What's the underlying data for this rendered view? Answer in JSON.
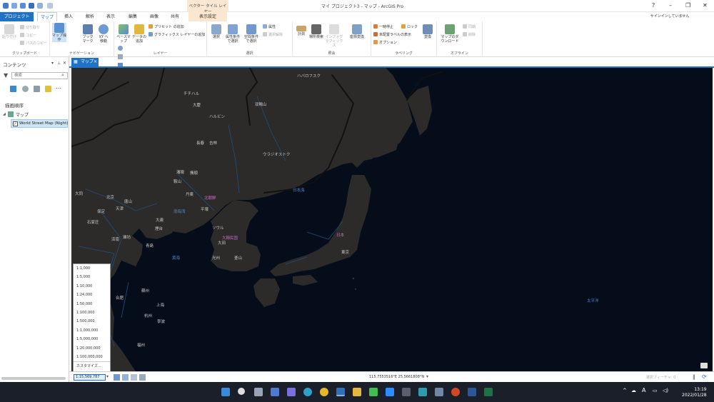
{
  "title_bar": {
    "title": "マイ プロジェクト3 - マップ - ArcGIS Pro",
    "context_header": "ベクター タイル レイヤー",
    "help": "?",
    "minimize": "–",
    "restore": "❐",
    "close": "✕"
  },
  "tabs": {
    "project": "プロジェクト",
    "map": "マップ",
    "insert": "挿入",
    "analysis": "解析",
    "view": "表示",
    "edit": "編集",
    "imagery": "画像",
    "share": "共有",
    "display_settings": "表示設定",
    "signin": "サインインしていません"
  },
  "ribbon": {
    "clipboard": {
      "paste": "貼り付け",
      "cut": "切り取り",
      "copy": "コピー",
      "copy_path": "パスのコピー",
      "label": "クリップボード"
    },
    "navigation": {
      "explore": "マップ操作",
      "bookmark": "ブックマーク",
      "go_to_xy": "XY へ移動",
      "label": "ナビゲーション"
    },
    "layer": {
      "basemap": "ベースマップ",
      "add_data": "データの追加",
      "add_preset": "プリセット の追加",
      "add_graphics": "グラフィックス レイヤーの追加",
      "label": "レイヤー"
    },
    "selection": {
      "select": "選択",
      "by_attribute": "属性条件で選択",
      "by_location": "空間条件で選択",
      "attributes": "属性",
      "clear": "選択解除",
      "label": "選択"
    },
    "inquiry": {
      "measure": "計測",
      "locate": "場所検索",
      "infographics": "インフォグラフィックス",
      "coordinate": "座標変換",
      "label": "照会"
    },
    "labeling": {
      "pause": "一時停止",
      "lock": "ロック",
      "unplaced": "未配置ラベルの表示",
      "more": "オプション",
      "convert": "変換",
      "label": "ラベリング"
    },
    "offline": {
      "download": "マップのダウンロード",
      "sync": "同期",
      "remove": "削除",
      "label": "オフライン"
    }
  },
  "contents": {
    "title": "コンテンツ",
    "search_placeholder": "検索",
    "drawing_order": "描画順序",
    "map_node": "マップ",
    "layer_name": "World Street Map (Night)"
  },
  "map_tab": {
    "label": "マップ",
    "close": "×"
  },
  "map_labels": [
    {
      "t": "ハバロフスク"
    },
    {
      "t": "チチハル"
    },
    {
      "t": "大慶"
    },
    {
      "t": "ハルビン"
    },
    {
      "t": "双鴨山"
    },
    {
      "t": "長春"
    },
    {
      "t": "吉林"
    },
    {
      "t": "ウラジオストク"
    },
    {
      "t": "瀋陽"
    },
    {
      "t": "撫順"
    },
    {
      "t": "鞍山"
    },
    {
      "t": "丹東"
    },
    {
      "t": "北朝鮮"
    },
    {
      "t": "平壌"
    },
    {
      "t": "大同"
    },
    {
      "t": "北京"
    },
    {
      "t": "唐山"
    },
    {
      "t": "保定"
    },
    {
      "t": "天津"
    },
    {
      "t": "石家荘"
    },
    {
      "t": "大連"
    },
    {
      "t": "渤海湾"
    },
    {
      "t": "煙台"
    },
    {
      "t": "済南"
    },
    {
      "t": "濰坊"
    },
    {
      "t": "青島"
    },
    {
      "t": "黄海"
    },
    {
      "t": "ソウル"
    },
    {
      "t": "大韓民国"
    },
    {
      "t": "大田"
    },
    {
      "t": "光州"
    },
    {
      "t": "釜山"
    },
    {
      "t": "日本海"
    },
    {
      "t": "日本"
    },
    {
      "t": "東京"
    },
    {
      "t": "南京"
    },
    {
      "t": "合肥"
    },
    {
      "t": "蘇州"
    },
    {
      "t": "上海"
    },
    {
      "t": "杭州"
    },
    {
      "t": "寧波"
    },
    {
      "t": "福州"
    },
    {
      "t": "太平洋"
    }
  ],
  "scale_options": [
    "1:1,000",
    "1:5,000",
    "1:10,000",
    "1:24,000",
    "1:50,000",
    "1:100,000",
    "1:500,000",
    "1:1,000,000",
    "1:5,000,000",
    "1:20,000,000",
    "1:100,000,000"
  ],
  "scale_custom": "カスタマイズ...",
  "status": {
    "scale": "1:15,569,787",
    "coordinates": "115.7553516°E 25.5661808°N",
    "selected_features": "選択フィーチャ: 0"
  },
  "taskbar": {
    "time": "13:19",
    "date": "2022/01/28"
  },
  "colors": {
    "accent": "#1f73c6",
    "map_bg": "#060d1a",
    "land": "#2d2b29",
    "context_tab": "#fbe7cf"
  }
}
